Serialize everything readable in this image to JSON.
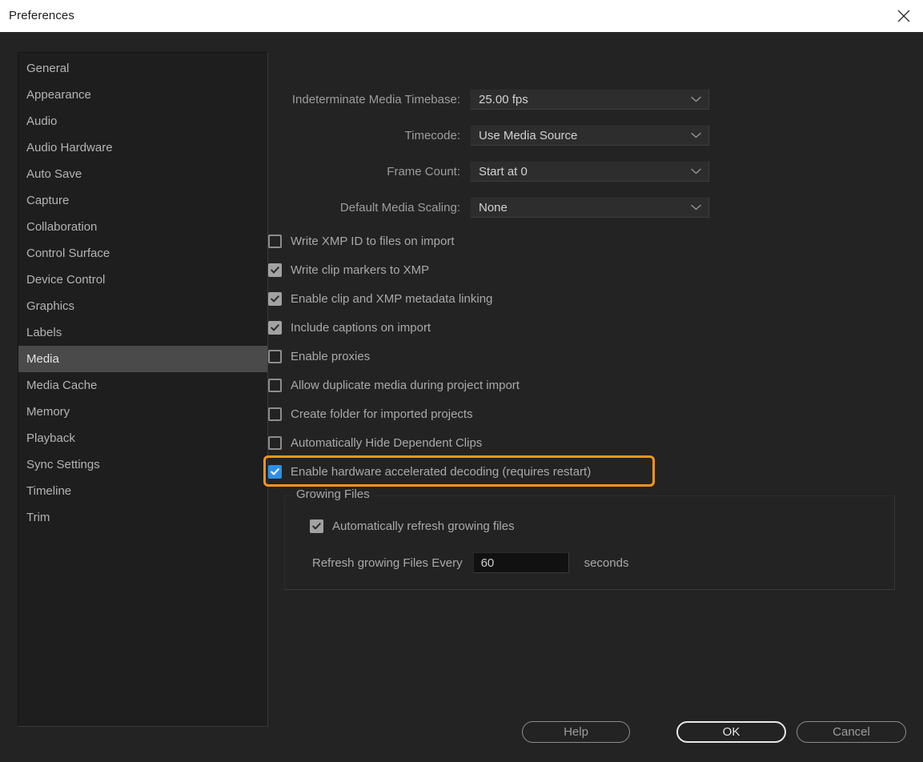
{
  "window": {
    "title": "Preferences",
    "close_icon": "close-icon"
  },
  "sidebar": {
    "items": [
      {
        "label": "General",
        "selected": false
      },
      {
        "label": "Appearance",
        "selected": false
      },
      {
        "label": "Audio",
        "selected": false
      },
      {
        "label": "Audio Hardware",
        "selected": false
      },
      {
        "label": "Auto Save",
        "selected": false
      },
      {
        "label": "Capture",
        "selected": false
      },
      {
        "label": "Collaboration",
        "selected": false
      },
      {
        "label": "Control Surface",
        "selected": false
      },
      {
        "label": "Device Control",
        "selected": false
      },
      {
        "label": "Graphics",
        "selected": false
      },
      {
        "label": "Labels",
        "selected": false
      },
      {
        "label": "Media",
        "selected": true
      },
      {
        "label": "Media Cache",
        "selected": false
      },
      {
        "label": "Memory",
        "selected": false
      },
      {
        "label": "Playback",
        "selected": false
      },
      {
        "label": "Sync Settings",
        "selected": false
      },
      {
        "label": "Timeline",
        "selected": false
      },
      {
        "label": "Trim",
        "selected": false
      }
    ]
  },
  "panel": {
    "dropdowns": [
      {
        "label": "Indeterminate Media Timebase:",
        "value": "25.00 fps"
      },
      {
        "label": "Timecode:",
        "value": "Use Media Source"
      },
      {
        "label": "Frame Count:",
        "value": "Start at 0"
      },
      {
        "label": "Default Media Scaling:",
        "value": "None"
      }
    ],
    "checkboxes": [
      {
        "label": "Write XMP ID to files on import",
        "checked": false
      },
      {
        "label": "Write clip markers to XMP",
        "checked": true
      },
      {
        "label": "Enable clip and XMP metadata linking",
        "checked": true
      },
      {
        "label": "Include captions on import",
        "checked": true
      },
      {
        "label": "Enable proxies",
        "checked": false
      },
      {
        "label": "Allow duplicate media during project import",
        "checked": false
      },
      {
        "label": "Create folder for imported projects",
        "checked": false
      },
      {
        "label": "Automatically Hide Dependent Clips",
        "checked": false
      },
      {
        "label": "Enable hardware accelerated decoding (requires restart)",
        "checked": true,
        "highlighted": true
      }
    ],
    "growing_files": {
      "legend": "Growing Files",
      "auto_refresh": {
        "label": "Automatically refresh growing files",
        "checked": true
      },
      "refresh_label": "Refresh growing Files Every",
      "refresh_value": "60",
      "seconds_label": "seconds"
    }
  },
  "buttons": {
    "help": "Help",
    "ok": "OK",
    "cancel": "Cancel"
  },
  "colors": {
    "highlight": "#f7941e",
    "checkbox_blue": "#2e8fe6",
    "selection": "#4a4a4a"
  }
}
